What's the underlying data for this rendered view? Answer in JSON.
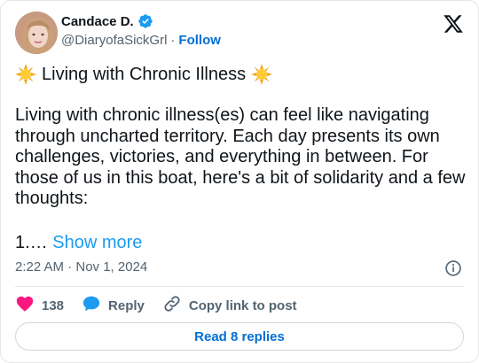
{
  "author": {
    "name": "Candace D.",
    "handle": "@DiaryofaSickGrl",
    "separator": "·",
    "follow_label": "Follow",
    "verified": true
  },
  "tweet": {
    "title": "Living with Chronic Illness",
    "title_emoji": "sun-with-rays",
    "body": "Living with chronic illness(es) can feel like navigating through uncharted territory. Each day presents its own challenges, victories, and everything in between. For those of us in this boat, here's a bit of solidarity and a few thoughts:",
    "tail": "1.…",
    "show_more_label": "Show more"
  },
  "meta": {
    "timestamp": "2:22 AM · Nov 1, 2024"
  },
  "actions": {
    "likes_count": "138",
    "reply_label": "Reply",
    "copy_link_label": "Copy link to post"
  },
  "footer": {
    "read_replies_label": "Read 8 replies"
  },
  "colors": {
    "link": "#1d9bf0",
    "follow": "#006fd6",
    "like": "#f91880",
    "reply": "#1d9bf0",
    "muted": "#536471",
    "text": "#0f1419"
  }
}
